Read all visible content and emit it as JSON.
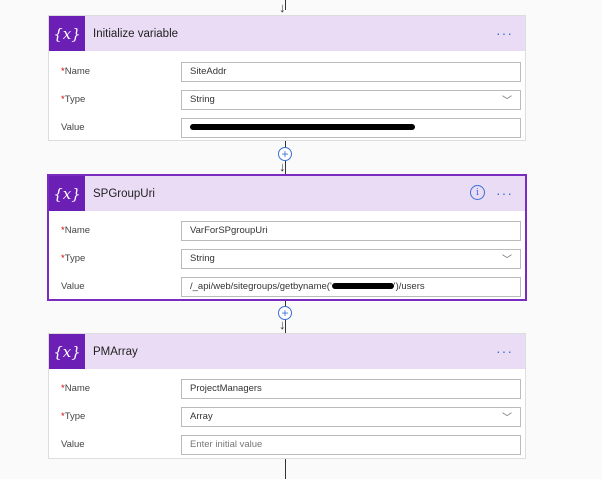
{
  "cards": [
    {
      "title": "Initialize variable",
      "icon": "{x}",
      "fields": {
        "name_label": "Name",
        "name": "SiteAddr",
        "type_label": "Type",
        "type": "String",
        "value_label": "Value"
      }
    },
    {
      "title": "SPGroupUri",
      "icon": "{x}",
      "fields": {
        "name_label": "Name",
        "name": "VarForSPgroupUri",
        "type_label": "Type",
        "type": "String",
        "value_label": "Value",
        "value_prefix": "/_api/web/sitegroups/getbyname('",
        "value_suffix": "')/users"
      }
    },
    {
      "title": "PMArray",
      "icon": "{x}",
      "fields": {
        "name_label": "Name",
        "name": "ProjectManagers",
        "type_label": "Type",
        "type": "Array",
        "value_label": "Value",
        "value_placeholder": "Enter initial value"
      }
    }
  ],
  "colors": {
    "accent": "#6c1fb5",
    "header": "#ebdcf5",
    "link": "#3a6fd6"
  }
}
